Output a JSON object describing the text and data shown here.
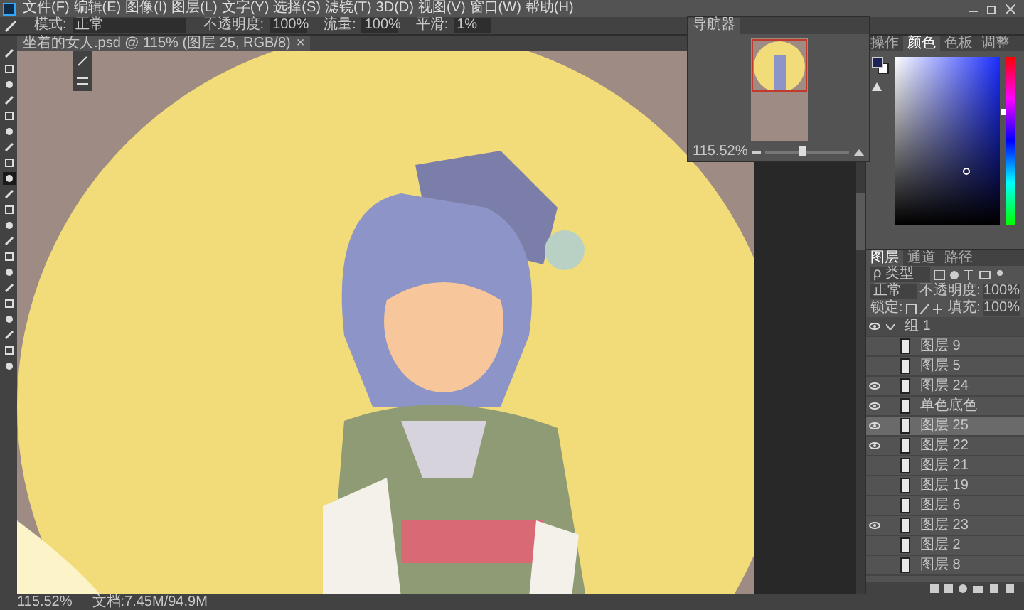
{
  "menu": [
    "文件(F)",
    "编辑(E)",
    "图像(I)",
    "图层(L)",
    "文字(Y)",
    "选择(S)",
    "滤镜(T)",
    "3D(D)",
    "视图(V)",
    "窗口(W)",
    "帮助(H)"
  ],
  "options": {
    "mode_label": "模式:",
    "mode": "正常",
    "opacity_label": "不透明度:",
    "opacity": "100%",
    "flow_label": "流量:",
    "flow": "100%",
    "smooth_label": "平滑:",
    "smooth": "1%"
  },
  "document_tab": {
    "title": "坐着的女人.psd @ 115% (图层 25, RGB/8)",
    "close": "×"
  },
  "tools": [
    {
      "selected": false
    },
    {
      "selected": false
    },
    {
      "selected": false
    },
    {
      "selected": false
    },
    {
      "selected": false
    },
    {
      "selected": false
    },
    {
      "selected": false
    },
    {
      "selected": false
    },
    {
      "selected": true
    },
    {
      "selected": false
    },
    {
      "selected": false
    },
    {
      "selected": false
    },
    {
      "selected": false
    },
    {
      "selected": false
    },
    {
      "selected": false
    },
    {
      "selected": false
    },
    {
      "selected": false
    },
    {
      "selected": false
    },
    {
      "selected": false
    },
    {
      "selected": false
    },
    {
      "selected": false
    }
  ],
  "navigator": {
    "title": "导航器",
    "zoom": "115.52%",
    "level": 0.45
  },
  "color_panel": {
    "tabs": [
      {
        "label": "操作",
        "selected": false
      },
      {
        "label": "颜色",
        "selected": true
      },
      {
        "label": "色板",
        "selected": false
      },
      {
        "label": "调整",
        "selected": false
      }
    ],
    "hue_slider": {
      "level": 0.67
    }
  },
  "layers_panel": {
    "tabs": [
      {
        "label": "图层",
        "selected": true
      },
      {
        "label": "通道",
        "selected": false
      },
      {
        "label": "路径",
        "selected": false
      }
    ],
    "filter": "ρ 类型",
    "blend": "正常",
    "opacity_label": "不透明度:",
    "opacity": "100%",
    "lock_label": "锁定:",
    "fill_label": "填充:",
    "fill": "100%",
    "layers": [
      {
        "kind": "group",
        "name": "组 1",
        "visible": true,
        "selected": false
      },
      {
        "kind": "layer",
        "name": "图层 9",
        "visible": false,
        "selected": false
      },
      {
        "kind": "layer",
        "name": "图层 5",
        "visible": false,
        "selected": false
      },
      {
        "kind": "layer",
        "name": "图层 24",
        "visible": true,
        "selected": false
      },
      {
        "kind": "layer",
        "name": "单色底色",
        "visible": true,
        "selected": false
      },
      {
        "kind": "layer",
        "name": "图层 25",
        "visible": true,
        "selected": true
      },
      {
        "kind": "layer",
        "name": "图层 22",
        "visible": true,
        "selected": false
      },
      {
        "kind": "layer",
        "name": "图层 21",
        "visible": false,
        "selected": false
      },
      {
        "kind": "layer",
        "name": "图层 19",
        "visible": false,
        "selected": false
      },
      {
        "kind": "layer",
        "name": "图层 6",
        "visible": false,
        "selected": false
      },
      {
        "kind": "layer",
        "name": "图层 23",
        "visible": true,
        "selected": false
      },
      {
        "kind": "layer",
        "name": "图层 2",
        "visible": false,
        "selected": false
      },
      {
        "kind": "layer",
        "name": "图层 8",
        "visible": false,
        "selected": false
      }
    ]
  },
  "status_bar": {
    "zoom": "115.52%",
    "document": "文档:7.45M/94.9M"
  }
}
